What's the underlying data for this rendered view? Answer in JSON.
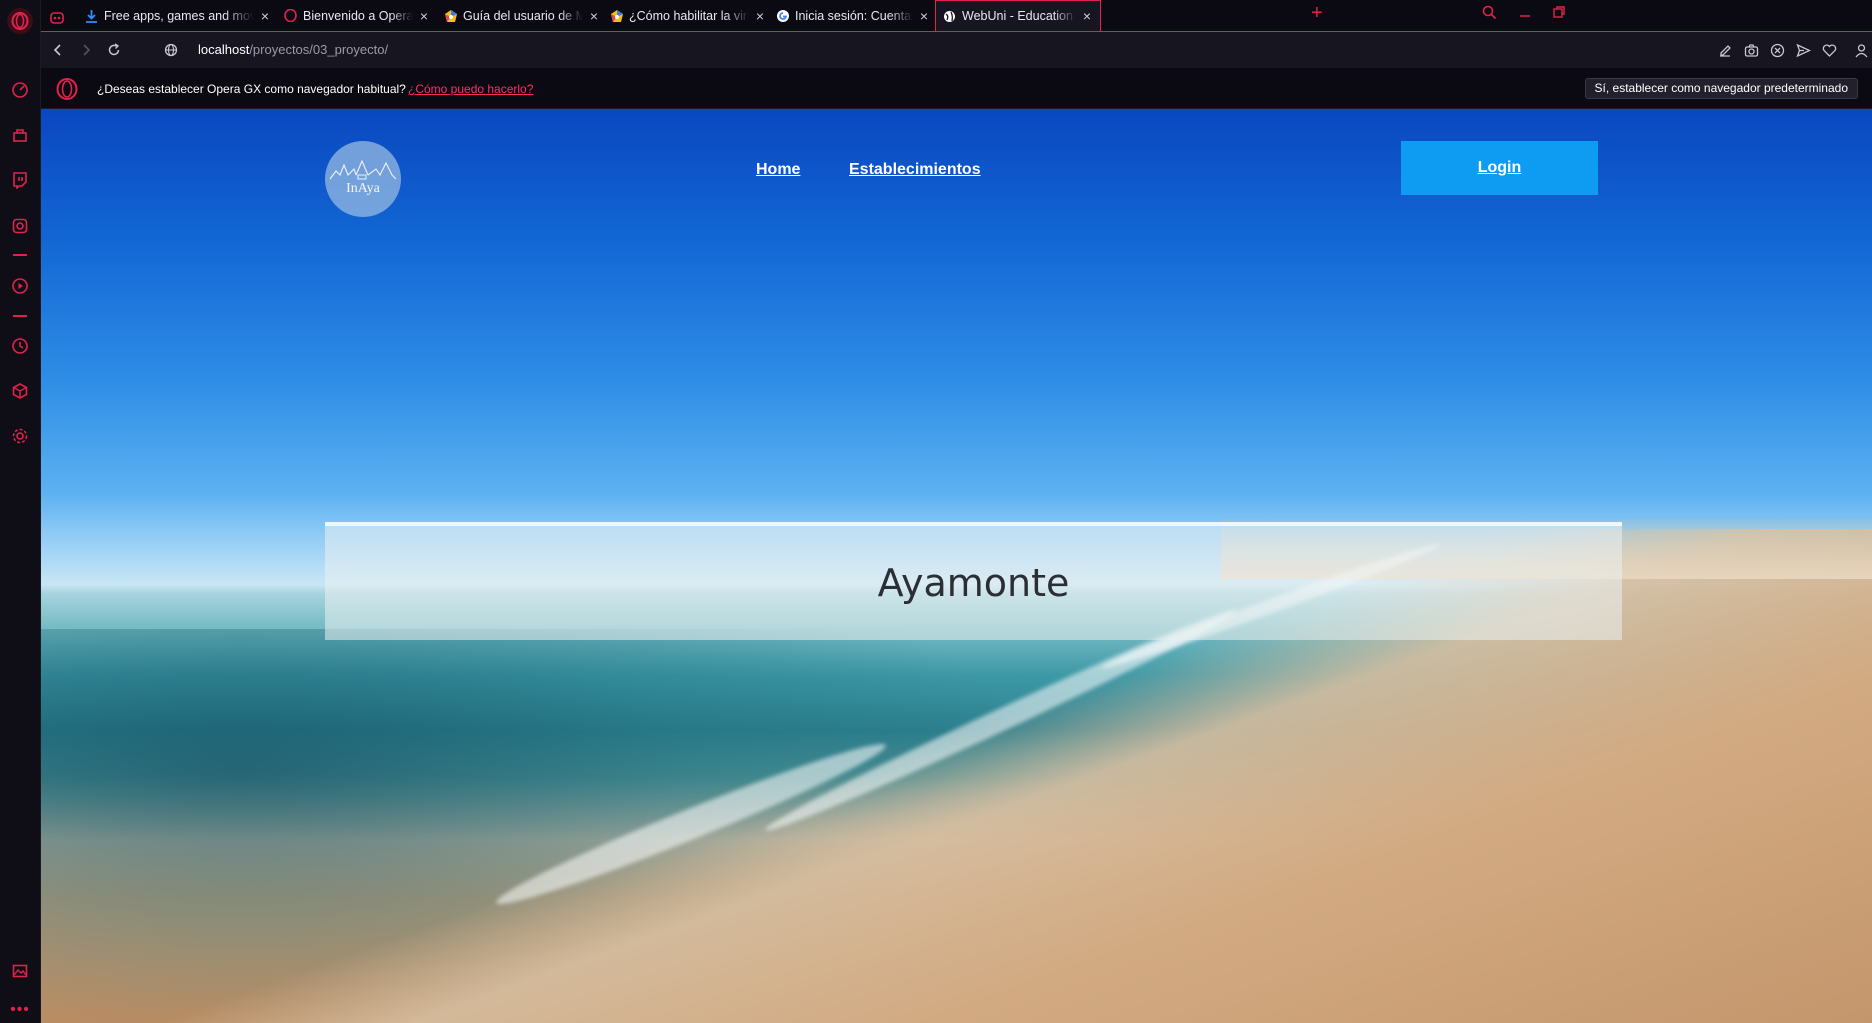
{
  "browser": {
    "tabs": [
      {
        "title": "Free apps, games and mov",
        "favicon": "download-icon",
        "active": false
      },
      {
        "title": "Bienvenido a Opera GX",
        "favicon": "opera-icon",
        "active": false
      },
      {
        "title": "Guía del usuario de MEmu",
        "favicon": "memu-icon",
        "active": false
      },
      {
        "title": "¿Cómo habilitar la virtualiz",
        "favicon": "memu-icon",
        "active": false
      },
      {
        "title": "Inicia sesión: Cuentas de G",
        "favicon": "google-icon",
        "active": false
      },
      {
        "title": "WebUni - Education Templ",
        "favicon": "globe-icon",
        "active": true
      }
    ],
    "close_glyph": "×",
    "new_tab_glyph": "+",
    "url_host": "localhost",
    "url_path": "/proyectos/03_proyecto/",
    "infobar": {
      "text": "¿Deseas establecer Opera GX como navegador habitual?",
      "link": "¿Cómo puedo hacerlo?",
      "button": "Sí, establecer como navegador predeterminado"
    },
    "accent_color": "#e0234d"
  },
  "page": {
    "logo_text": "InAya",
    "nav": [
      {
        "label": "Home"
      },
      {
        "label": "Establecimientos"
      }
    ],
    "login_label": "Login",
    "hero_title": "Ayamonte",
    "login_color": "#0d9cf2"
  }
}
